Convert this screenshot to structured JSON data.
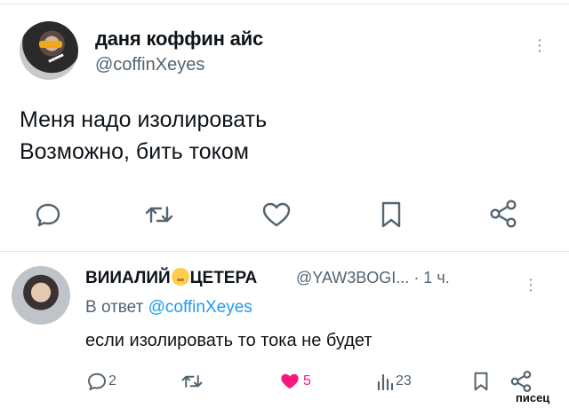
{
  "tweet": {
    "author_name": "даня коффин айс",
    "author_handle": "@coffinXeyes",
    "text_lines": [
      "Меня надо изолировать",
      "Возможно, бить током"
    ],
    "actions": [
      "reply-icon",
      "retweet-icon",
      "like-icon",
      "bookmark-icon",
      "share-icon"
    ]
  },
  "reply": {
    "author_name_left": "ВИИАЛИЙ",
    "author_name_right": "ЦЕТЕРА",
    "author_handle": "@YAW3BOGI...",
    "time": "· 1 ч.",
    "reply_prefix": "В ответ",
    "reply_to": "@coffinXeyes",
    "text": "если изолировать то тока не будет",
    "reply_count": "2",
    "like_count": "5",
    "view_count": "23",
    "like_color": "#f91880"
  },
  "watermark": "писец"
}
